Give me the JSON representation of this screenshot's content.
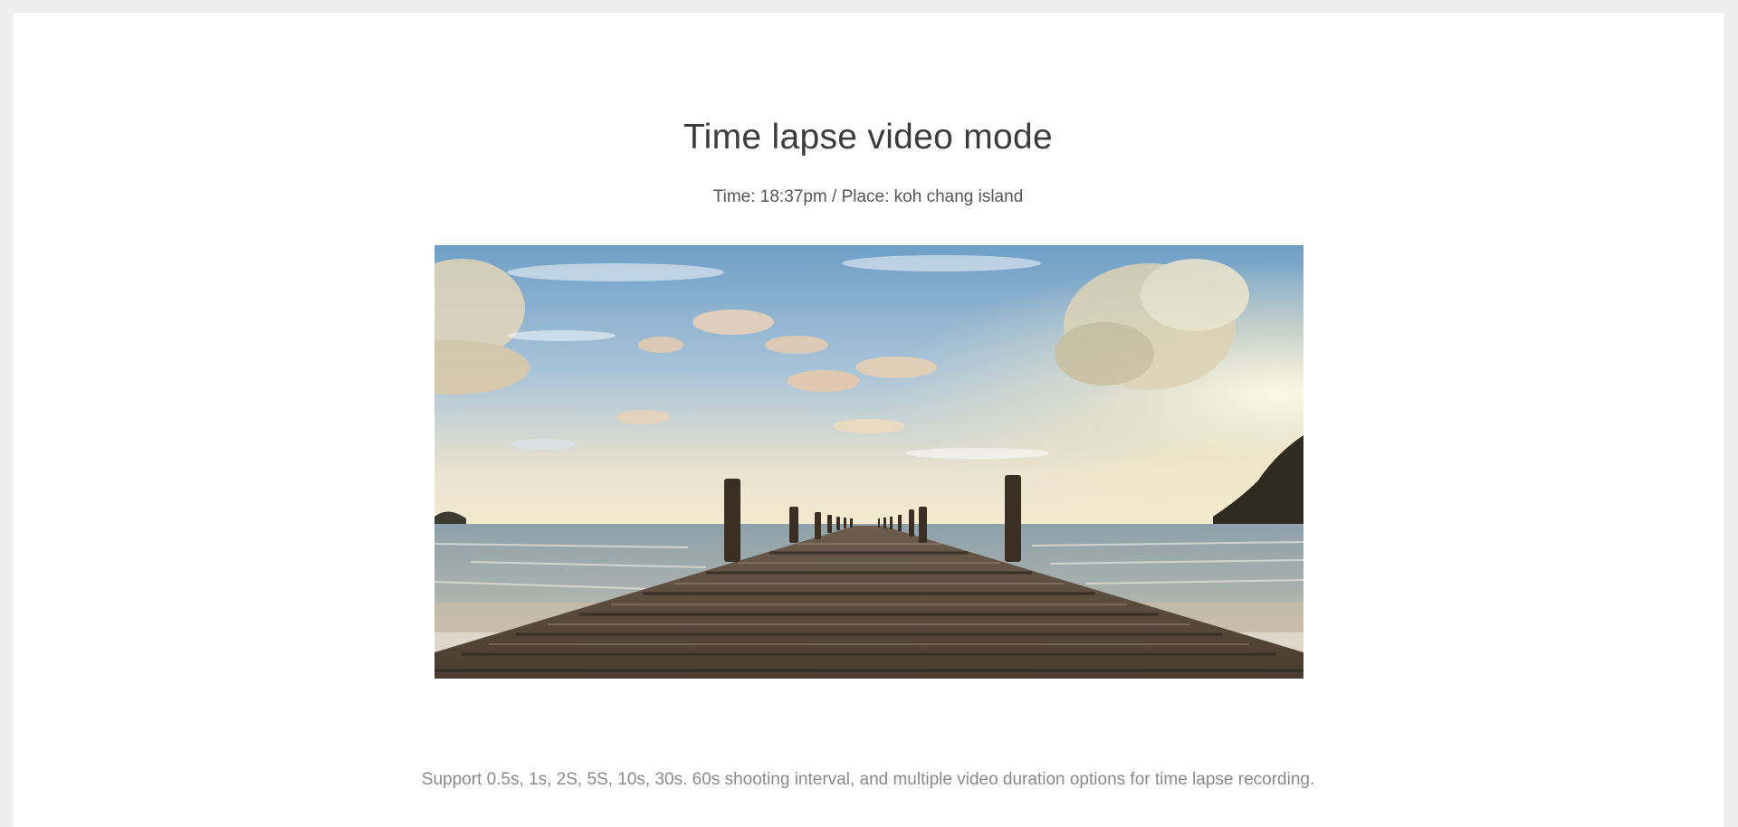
{
  "section": {
    "title": "Time lapse video mode",
    "subtitle": "Time: 18:37pm / Place: koh chang island",
    "description": "Support 0.5s, 1s, 2S, 5S, 10s, 30s. 60s shooting interval, and multiple video duration options for time lapse recording."
  },
  "photo": {
    "subject": "wooden pier extending into the sea at sunset",
    "colors": {
      "sky_top": "#7aa6c9",
      "sky_horizon": "#f3e6c4",
      "sea": "#7d8c95",
      "wood_dark": "#3b2f24",
      "wood_light": "#8c7a66",
      "sun_glow": "#fff6dc"
    }
  }
}
